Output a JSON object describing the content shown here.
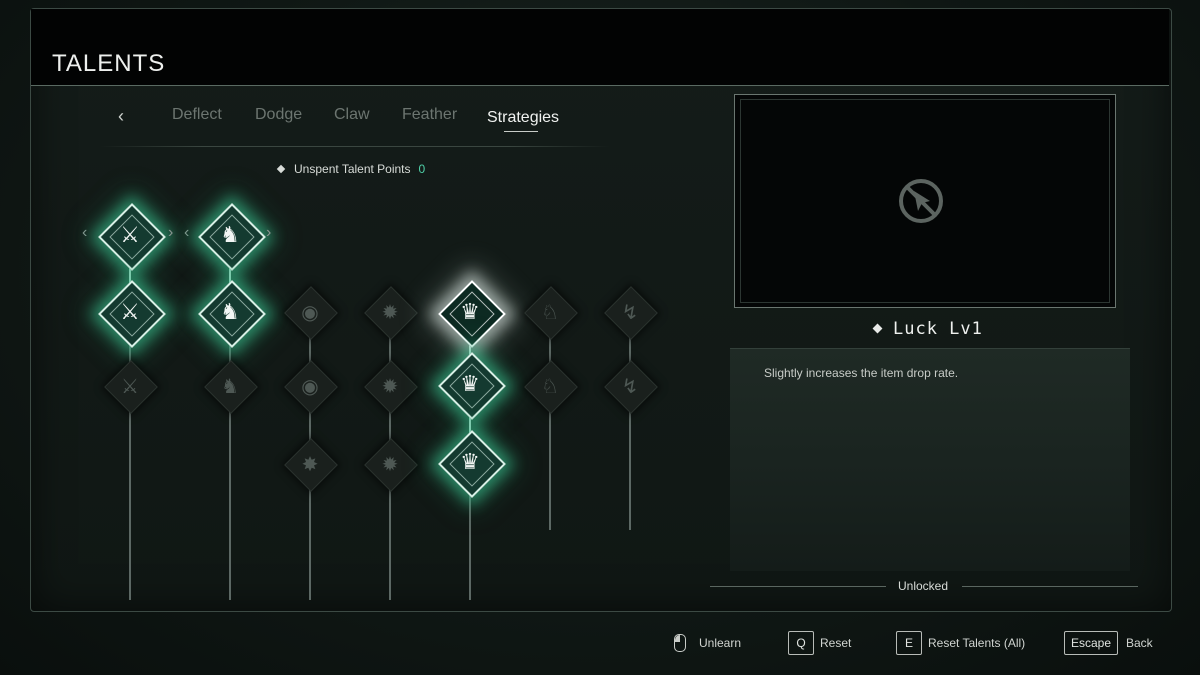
{
  "header": {
    "title": "TALENTS"
  },
  "tabs": {
    "back_icon": "chevron-left-icon",
    "items": [
      {
        "label": "Deflect",
        "active": false
      },
      {
        "label": "Dodge",
        "active": false
      },
      {
        "label": "Claw",
        "active": false
      },
      {
        "label": "Feather",
        "active": false
      },
      {
        "label": "Strategies",
        "active": true
      }
    ]
  },
  "points": {
    "label": "Unspent Talent Points",
    "value": "0"
  },
  "tree": {
    "node_states": [
      "active",
      "selected",
      "locked"
    ],
    "icons": [
      "crossed-axes-icon",
      "armored-figure-icon",
      "hooded-mask-icon",
      "spiked-orb-icon",
      "crown-icon",
      "dragon-head-icon",
      "lightning-staff-icon"
    ],
    "colors": {
      "active_glow": "#3cc896",
      "selected_glow": "#ffffff",
      "points_value": "#4fd0a8"
    }
  },
  "detail": {
    "name": "Luck Lv1",
    "description": "Slightly increases the item drop rate.",
    "status": "Unlocked",
    "preview_icon": "no-video-icon"
  },
  "footer": {
    "unlearn": {
      "icon": "mouse-icon",
      "label": "Unlearn"
    },
    "reset": {
      "key": "Q",
      "label": "Reset"
    },
    "reset_all": {
      "key": "E",
      "label": "Reset Talents (All)"
    },
    "back": {
      "key": "Escape",
      "label": "Back"
    }
  }
}
